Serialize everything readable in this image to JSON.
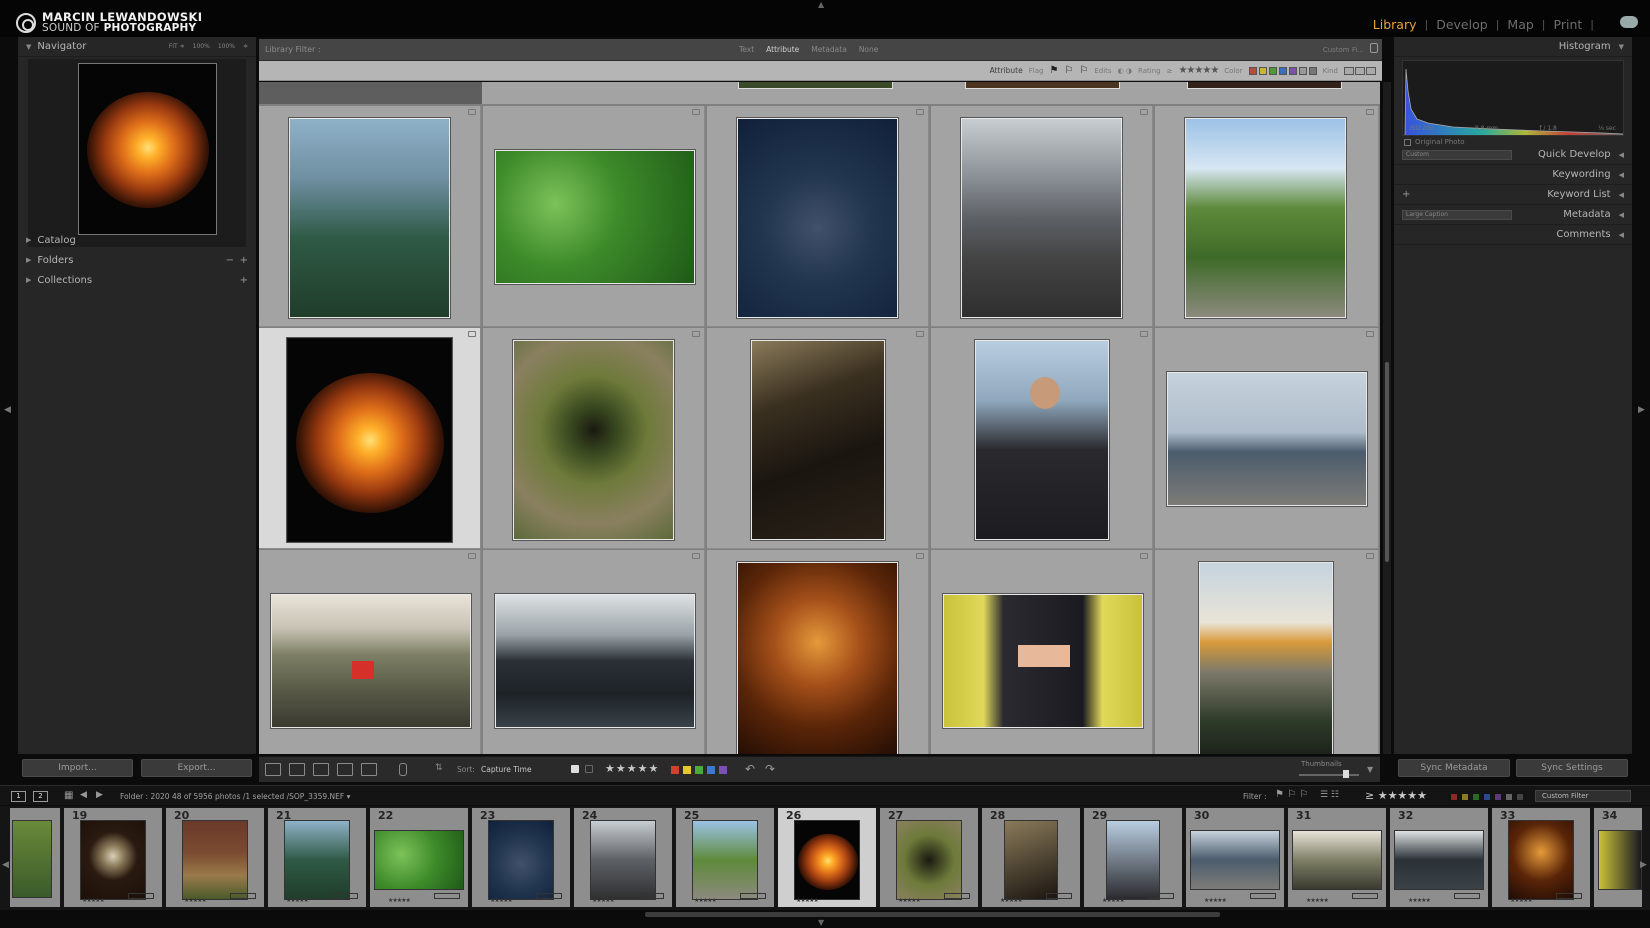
{
  "brand": {
    "line1": "MARCIN LEWANDOWSKI",
    "line2_a": "SOUND OF",
    "line2_b": "PHOTOGRAPHY"
  },
  "modules": [
    {
      "label": "Library",
      "active": true
    },
    {
      "label": "Develop",
      "active": false
    },
    {
      "label": "Map",
      "active": false
    },
    {
      "label": "Print",
      "active": false
    }
  ],
  "left": {
    "navigator": {
      "title": "Navigator",
      "zoom": [
        "FIT ≑",
        "100%",
        "100%",
        "≑"
      ]
    },
    "sections": [
      {
        "label": "Catalog",
        "minus": false,
        "plus": false
      },
      {
        "label": "Folders",
        "minus": true,
        "plus": true
      },
      {
        "label": "Collections",
        "minus": false,
        "plus": true
      }
    ],
    "import_label": "Import...",
    "export_label": "Export..."
  },
  "right": {
    "histogram": {
      "title": "Histogram",
      "iso": "ISO 200",
      "focal": "8.8 mm",
      "aperture": "ƒ / 1.8",
      "shutter": "⅛ sec",
      "original_photo": "Original Photo"
    },
    "quick_develop": {
      "title": "Quick Develop",
      "preset": "Custom"
    },
    "keywording": "Keywording",
    "keyword_list": "Keyword List",
    "metadata": {
      "title": "Metadata",
      "preset": "Large Caption"
    },
    "comments": "Comments",
    "sync_metadata": "Sync Metadata",
    "sync_settings": "Sync Settings"
  },
  "filter_bar": {
    "label": "Library Filter :",
    "tabs": [
      {
        "label": "Text",
        "active": false
      },
      {
        "label": "Attribute",
        "active": true
      },
      {
        "label": "Metadata",
        "active": false
      },
      {
        "label": "None",
        "active": false
      }
    ],
    "custom": "Custom Fi..."
  },
  "attribute_bar": {
    "attribute": "Attribute",
    "flag": "Flag",
    "edits": "Edits",
    "rating": "Rating",
    "color": "Color",
    "kind": "Kind",
    "stars": "★★★★★"
  },
  "toolbar": {
    "sort_label": "Sort:",
    "sort_value": "Capture Time",
    "stars": "★★★★★",
    "thumbnails_label": "Thumbnails"
  },
  "filmstrip_header": {
    "page1": "1",
    "page2": "2",
    "info": "Folder : 2020     48 of 5956 photos /1 selected /SOP_3359.NEF ▾",
    "filter_label": "Filter :",
    "stars": "≥ ★★★★★",
    "custom_filter": "Custom Filter"
  },
  "filmstrip": {
    "numbers": [
      "",
      "19",
      "20",
      "21",
      "22",
      "23",
      "24",
      "25",
      "26",
      "27",
      "28",
      "29",
      "30",
      "31",
      "32",
      "33",
      "34"
    ],
    "stars": "★★★★★"
  },
  "colors": {
    "accent": "#e8a33a",
    "labels": [
      "#d4402f",
      "#e3c92b",
      "#4bab3a",
      "#3a7ad0",
      "#7b4fb8"
    ]
  }
}
